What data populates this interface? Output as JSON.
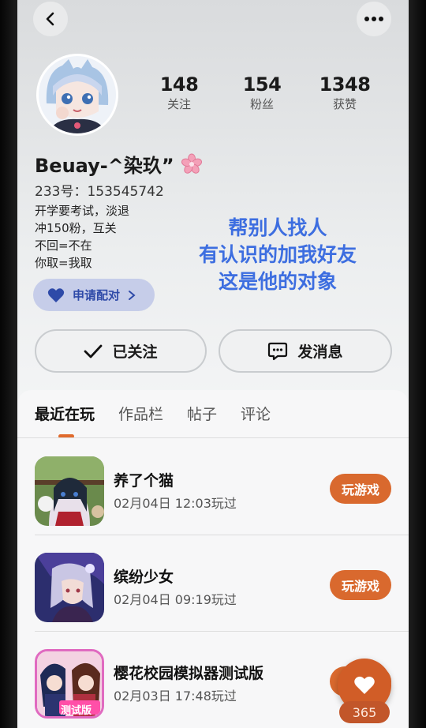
{
  "profile": {
    "name": "Beuay-^染玖”",
    "uid": "233号：153545742",
    "bio": [
      "开学要考试，淡退",
      "冲150粉，互关",
      "不回=不在",
      "你取=我取"
    ],
    "stats": [
      {
        "value": "148",
        "label": "关注"
      },
      {
        "value": "154",
        "label": "粉丝"
      },
      {
        "value": "1348",
        "label": "获赞"
      }
    ],
    "pair_button": "申请配对"
  },
  "overlay_text": [
    "帮别人找人",
    "有认识的加我好友",
    "这是他的对象"
  ],
  "actions": {
    "follow": "已关注",
    "message": "发消息"
  },
  "tabs": [
    "最近在玩",
    "作品栏",
    "帖子",
    "评论"
  ],
  "games": [
    {
      "title": "养了个猫",
      "time": "02月04日 12:03玩过",
      "button": "玩游戏"
    },
    {
      "title": "缤纷少女",
      "time": "02月04日 09:19玩过",
      "button": "玩游戏"
    },
    {
      "title": "樱花校园模拟器测试版",
      "time": "02月03日 17:48玩过",
      "button": "玩游戏",
      "thumb_badge": "测试版"
    }
  ],
  "like_count": "365",
  "colors": {
    "accent": "#d9692e",
    "overlay_blue": "#3d6ee0",
    "pair_bg": "#c6cde9"
  }
}
